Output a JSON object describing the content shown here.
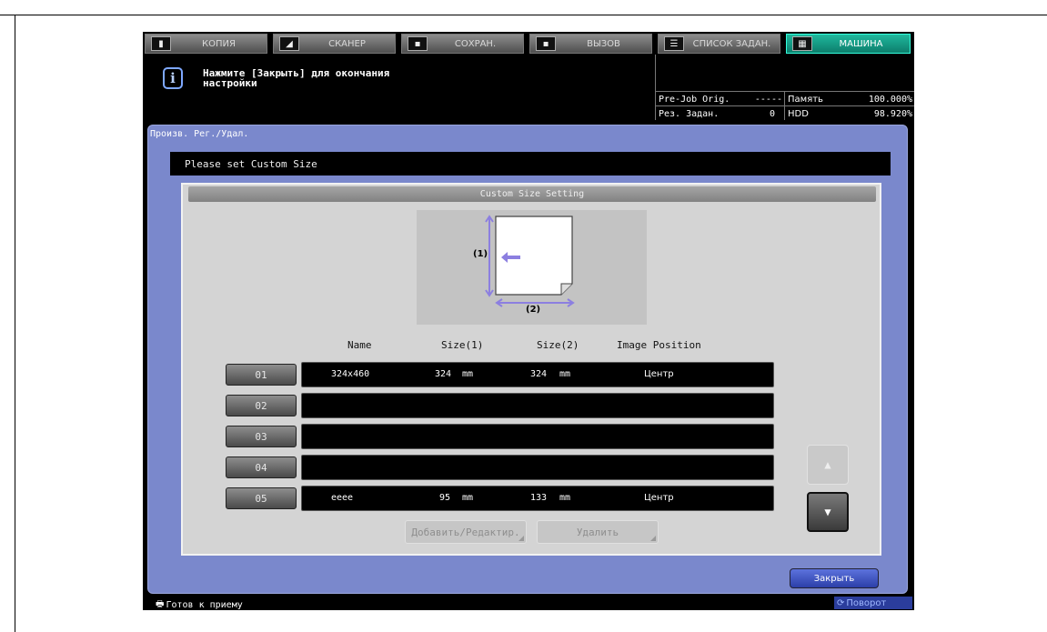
{
  "tabs": [
    {
      "label": "КОПИЯ",
      "icon": "copy-icon"
    },
    {
      "label": "СКАНЕР",
      "icon": "scanner-icon"
    },
    {
      "label": "СОХРАН.",
      "icon": "save-icon"
    },
    {
      "label": "ВЫЗОВ",
      "icon": "recall-icon"
    },
    {
      "label": "СПИСОК ЗАДАН.",
      "icon": "job-list-icon"
    },
    {
      "label": "МАШИНА",
      "icon": "machine-icon"
    }
  ],
  "message": {
    "icon": "info-icon",
    "line1": "Нажмите [Закрыть] для окончания",
    "line2": "настройки"
  },
  "status": {
    "prejob_label": "Pre-Job Orig.",
    "prejob_value": "-----",
    "jobs_label": "Рез. Задан.",
    "jobs_value": "0",
    "memory_label": "Память",
    "memory_value": "100.000%",
    "hdd_label": "HDD",
    "hdd_value": "98.920%"
  },
  "panel": {
    "title": "Произв. Рег./Удал.",
    "instruction": "Please set Custom Size",
    "section_title": "Custom Size Setting"
  },
  "diagram": {
    "label1": "(1)",
    "label2": "(2)"
  },
  "table": {
    "headers": [
      "Name",
      "Size(1)",
      "Size(2)",
      "Image Position"
    ],
    "rows": [
      {
        "num": "01",
        "name": "324x460",
        "size1": "324",
        "size2": "324",
        "unit": "mm",
        "position": "Центр"
      },
      {
        "num": "02",
        "name": "",
        "size1": "",
        "size2": "",
        "unit": "",
        "position": ""
      },
      {
        "num": "03",
        "name": "",
        "size1": "",
        "size2": "",
        "unit": "",
        "position": ""
      },
      {
        "num": "04",
        "name": "",
        "size1": "",
        "size2": "",
        "unit": "",
        "position": ""
      },
      {
        "num": "05",
        "name": "eeee",
        "size1": "95",
        "size2": "133",
        "unit": "mm",
        "position": "Центр"
      }
    ]
  },
  "actions": {
    "add_edit": "Добавить/Редактир.",
    "delete": "Удалить"
  },
  "close_label": "Закрыть",
  "footer": {
    "status": "Готов к приему",
    "rotate": "Поворот"
  },
  "colors": {
    "panel_blue": "#7a88cc",
    "active_tab": "#15a08a",
    "close_button": "#3a4fc0"
  }
}
